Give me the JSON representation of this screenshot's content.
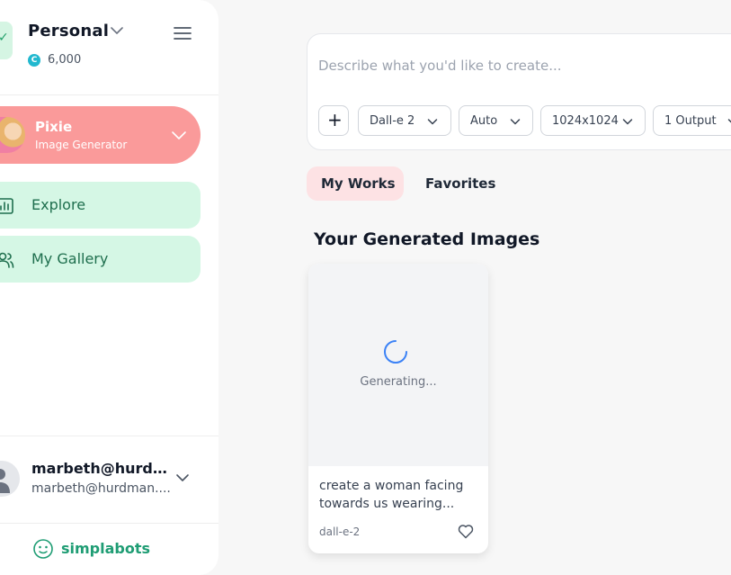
{
  "colors": {
    "accent_green": "#1f9d74",
    "nav_bg": "#d5f7e5",
    "bot_bg": "#fa9a9a",
    "tab_active_bg": "#fde2e4",
    "page_bg": "#f7f7f7"
  },
  "sidebar": {
    "workspace": {
      "name": "Personal",
      "credits": "6,000",
      "credit_icon": "C"
    },
    "bot": {
      "name": "Pixie",
      "subtitle": "Image Generator"
    },
    "nav": [
      {
        "label": "Explore",
        "icon": "bar-chart-icon"
      },
      {
        "label": "My Gallery",
        "icon": "users-icon"
      }
    ],
    "user": {
      "name": "marbeth@hurdm...",
      "email": "marbeth@hurdman...."
    },
    "brand": {
      "name": "simplabots",
      "icon": "robot-face-icon"
    }
  },
  "prompt": {
    "placeholder": "Describe what you'd like to create...",
    "add_label": "+",
    "model": "Dall-e 2",
    "quality": "Auto",
    "size": "1024x1024",
    "outputs": "1 Output"
  },
  "tabs": [
    {
      "label": "My Works",
      "active": true
    },
    {
      "label": "Favorites",
      "active": false
    }
  ],
  "section": {
    "title": "Your Generated Images"
  },
  "images": [
    {
      "status": "Generating...",
      "prompt": "create a woman facing towards us wearing...",
      "model": "dall-e-2",
      "icon": "heart-icon"
    }
  ]
}
